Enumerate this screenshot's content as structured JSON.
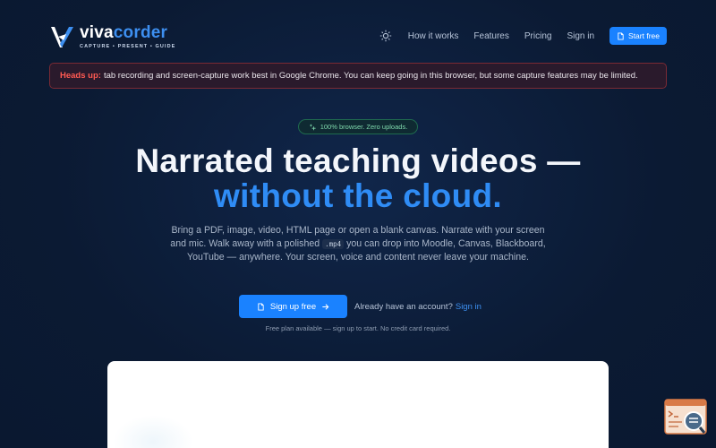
{
  "brand": {
    "name_part1": "viva",
    "name_part2": "corder",
    "tagline": "CAPTURE • PRESENT • GUIDE",
    "accent": "#1a82ff"
  },
  "nav": {
    "theme_icon": "sun-icon",
    "links": [
      "How it works",
      "Features",
      "Pricing",
      "Sign in"
    ],
    "cta_label": "Start free"
  },
  "alert": {
    "label": "Heads up:",
    "text": "tab recording and screen-capture work best in Google Chrome. You can keep going in this browser, but some capture features may be limited."
  },
  "hero": {
    "pill": "100% browser. Zero uploads.",
    "title_line1": "Narrated teaching videos —",
    "title_line2": "without the cloud.",
    "lead_part1": "Bring a PDF, image, video, HTML page or open a blank canvas. Narrate with your screen and mic. Walk away with a polished",
    "lead_code": ".mp4",
    "lead_part2": "you can drop into Moodle, Canvas, Blackboard, YouTube — anywhere. Your screen, voice and content never leave your machine.",
    "cta_label": "Sign up free",
    "have_account": "Already have an account?",
    "signin_link": "Sign in",
    "note": "Free plan available — sign up to start. No credit card required."
  },
  "widget": {
    "icon": "terminal-search-icon"
  }
}
